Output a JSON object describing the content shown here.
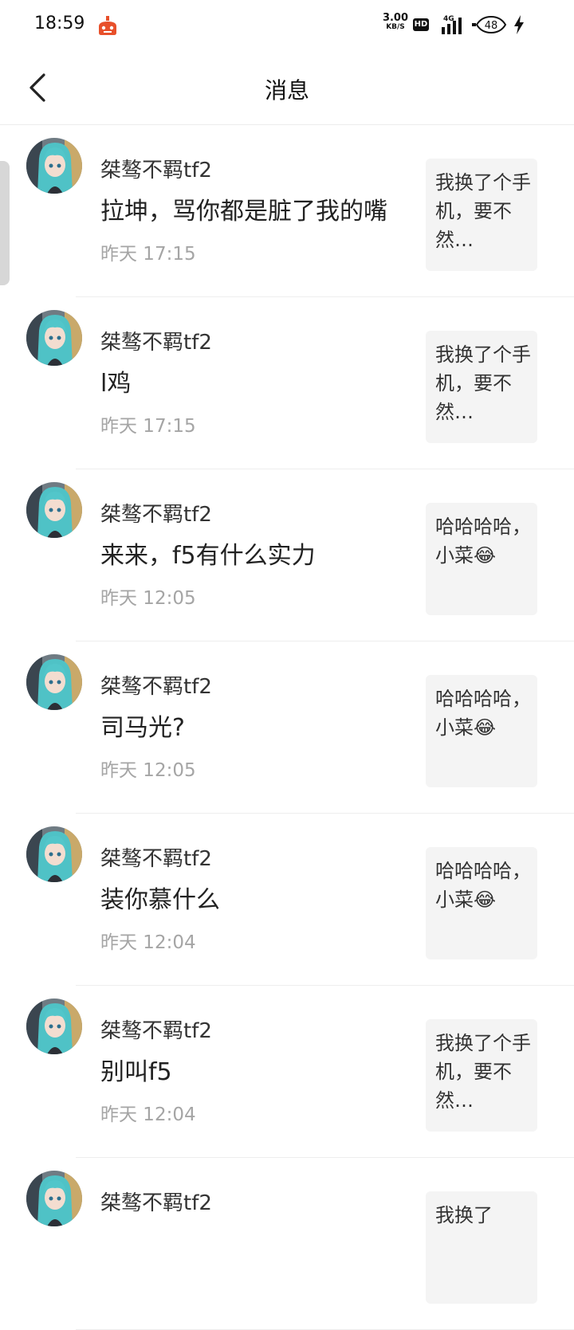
{
  "status_bar": {
    "time": "18:59",
    "net_speed_value": "3.00",
    "net_speed_unit": "KB/S",
    "hd_badge": "HD",
    "network_type": "4G",
    "battery_level": "48"
  },
  "header": {
    "title": "消息"
  },
  "messages": [
    {
      "sender": "桀骜不羁tf2",
      "content": "拉坤，骂你都是脏了我的嘴",
      "time": "昨天 17:15",
      "quote": " 我换了个手机，要不然…"
    },
    {
      "sender": "桀骜不羁tf2",
      "content": "l鸡",
      "time": "昨天 17:15",
      "quote": " 我换了个手机，要不然…"
    },
    {
      "sender": "桀骜不羁tf2",
      "content": "来来，f5有什么实力",
      "time": "昨天 12:05",
      "quote": "哈哈哈哈，小菜😂"
    },
    {
      "sender": "桀骜不羁tf2",
      "content": "司马光?",
      "time": "昨天 12:05",
      "quote": "哈哈哈哈，小菜😂"
    },
    {
      "sender": "桀骜不羁tf2",
      "content": "装你慕什么",
      "time": "昨天 12:04",
      "quote": "哈哈哈哈，小菜😂"
    },
    {
      "sender": "桀骜不羁tf2",
      "content": "别叫f5",
      "time": "昨天 12:04",
      "quote": " 我换了个手机，要不然…"
    },
    {
      "sender": "桀骜不羁tf2",
      "content": "",
      "time": "",
      "quote": " 我换了"
    }
  ]
}
